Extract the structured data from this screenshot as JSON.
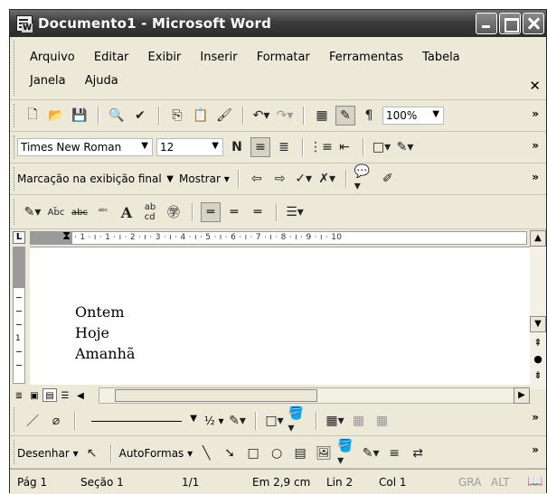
{
  "window": {
    "title": "Documento1 - Microsoft Word"
  },
  "menu": {
    "items": [
      "Arquivo",
      "Editar",
      "Exibir",
      "Inserir",
      "Formatar",
      "Ferramentas",
      "Tabela",
      "Janela",
      "Ajuda"
    ]
  },
  "standard_toolbar": {
    "zoom": "100%"
  },
  "formatting_toolbar": {
    "font": "Times New Roman",
    "size": "12"
  },
  "reviewing_toolbar": {
    "display_mode": "Marcação na exibição final",
    "show_label": "Mostrar"
  },
  "ruler": {
    "ticks": "· 1 · ı · 1 · ı · 2 · ı · 3 · ı · 4 · ı · 5 · ı · 6 · ı · 7 · ı · 8 · ı · 9 · ı · 10"
  },
  "document": {
    "lines": [
      "Ontem",
      "Hoje",
      "Amanhã"
    ]
  },
  "drawing_toolbar": {
    "line_weight": "½",
    "draw_label": "Desenhar",
    "autoshapes_label": "AutoFormas"
  },
  "status": {
    "page": "Pág 1",
    "section": "Seção 1",
    "page_of": "1/1",
    "position": "Em 2,9 cm",
    "line": "Lin 2",
    "column": "Col 1",
    "rec": "GRA",
    "alt": "ALT"
  }
}
